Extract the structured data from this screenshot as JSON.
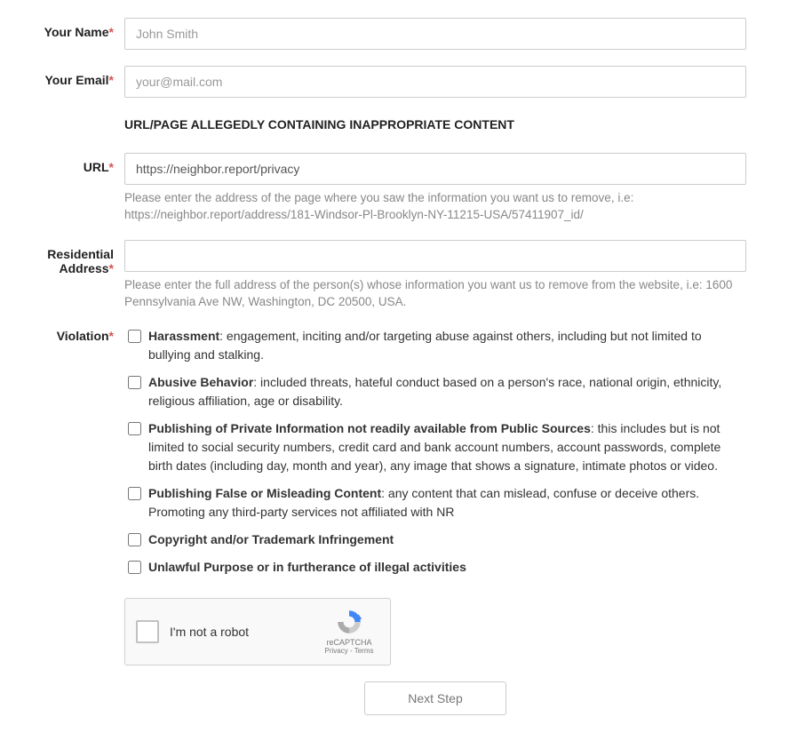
{
  "fields": {
    "name": {
      "label": "Your Name",
      "required": "*",
      "placeholder": "John Smith",
      "value": ""
    },
    "email": {
      "label": "Your Email",
      "required": "*",
      "placeholder": "your@mail.com",
      "value": ""
    },
    "url": {
      "label": "URL",
      "required": "*",
      "placeholder": "",
      "value": "https://neighbor.report/privacy",
      "helper": "Please enter the address of the page where you saw the information you want us to remove, i.e: https://neighbor.report/address/181-Windsor-Pl-Brooklyn-NY-11215-USA/57411907_id/"
    },
    "address": {
      "label": "Residential Address",
      "required": "*",
      "placeholder": "",
      "value": "",
      "helper": "Please enter the full address of the person(s) whose information you want us to remove from the website, i.e: 1600 Pennsylvania Ave NW, Washington, DC 20500, USA."
    },
    "violation": {
      "label": "Violation",
      "required": "*"
    }
  },
  "section_header": "URL/PAGE ALLEGEDLY CONTAINING INAPPROPRIATE CONTENT",
  "violations": [
    {
      "bold": "Harassment",
      "rest": ": engagement, inciting and/or targeting abuse against others, including but not limited to bullying and stalking."
    },
    {
      "bold": "Abusive Behavior",
      "rest": ": included threats, hateful conduct based on a person's race, national origin, ethnicity, religious affiliation, age or disability."
    },
    {
      "bold": "Publishing of Private Information not readily available from Public Sources",
      "rest": ": this includes but is not limited to social security numbers, credit card and bank account numbers, account passwords, complete birth dates (including day, month and year), any image that shows a signature, intimate photos or video."
    },
    {
      "bold": "Publishing False or Misleading Content",
      "rest": ": any content that can mislead, confuse or deceive others. Promoting any third-party services not affiliated with NR"
    },
    {
      "bold": "Copyright and/or Trademark Infringement",
      "rest": ""
    },
    {
      "bold": "Unlawful Purpose or in furtherance of illegal activities",
      "rest": ""
    }
  ],
  "recaptcha": {
    "label": "I'm not a robot",
    "brand": "reCAPTCHA",
    "links": "Privacy - Terms"
  },
  "button": {
    "next": "Next Step"
  }
}
